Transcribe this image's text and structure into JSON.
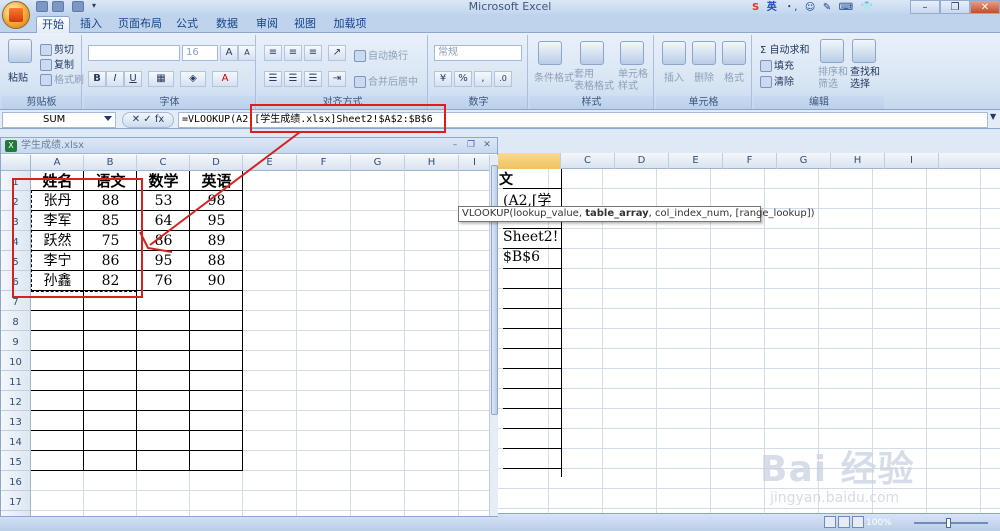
{
  "app": {
    "title": "Microsoft Excel",
    "ime_items": [
      "S",
      "英",
      "・,",
      "☺",
      "✎",
      "⌨",
      "♛",
      "👕",
      "✿"
    ]
  },
  "window_controls": {
    "minimize": "–",
    "restore": "❐",
    "close": "✕"
  },
  "ribbon_tabs": [
    "开始",
    "插入",
    "页面布局",
    "公式",
    "数据",
    "审阅",
    "视图",
    "加载项"
  ],
  "ribbon": {
    "clipboard": {
      "paste": "粘贴",
      "cut": "剪切",
      "copy": "复制",
      "format_painter": "格式刷",
      "label": "剪贴板"
    },
    "font": {
      "font_name": "",
      "font_size": "16",
      "grow": "A",
      "shrink": "A",
      "bold": "B",
      "italic": "I",
      "underline": "U",
      "label": "字体"
    },
    "alignment": {
      "wrap": "自动换行",
      "merge": "合并后居中",
      "label": "对齐方式"
    },
    "number": {
      "format": "常规",
      "percent": "%",
      "comma": ",",
      "label": "数字"
    },
    "styles": {
      "conditional": "条件格式",
      "table": "套用\n表格格式",
      "cell_styles": "单元格\n样式",
      "label": "样式"
    },
    "cells": {
      "insert": "插入",
      "delete": "删除",
      "format": "格式",
      "label": "单元格"
    },
    "editing": {
      "autosum": "Σ 自动求和",
      "fill": "填充",
      "clear": "清除",
      "sort": "排序和\n筛选",
      "find": "查找和\n选择",
      "label": "编辑"
    }
  },
  "formula_bar": {
    "name_box": "SUM",
    "buttons": "✕ ✓ fx",
    "formula": "=VLOOKUP(A2,[学生成绩.xlsx]Sheet2!$A$2:$B$6"
  },
  "tooltip": {
    "pre": "VLOOKUP(lookup_value, ",
    "bold": "table_array",
    "post": ", col_index_num, [range_lookup])"
  },
  "fg_window": {
    "title": "学生成绩.xlsx",
    "columns": [
      "A",
      "B",
      "C",
      "D",
      "E",
      "F",
      "G",
      "H",
      "I"
    ],
    "rows": [
      "1",
      "2",
      "3",
      "4",
      "5",
      "6",
      "7",
      "8",
      "9",
      "10",
      "11",
      "12",
      "13",
      "14",
      "15",
      "16",
      "17"
    ],
    "table": {
      "headers": [
        "姓名",
        "语文",
        "数学",
        "英语"
      ],
      "data": [
        [
          "张丹",
          "88",
          "53",
          "98"
        ],
        [
          "李军",
          "85",
          "64",
          "95"
        ],
        [
          "跃然",
          "75",
          "86",
          "89"
        ],
        [
          "李宁",
          "86",
          "95",
          "88"
        ],
        [
          "孙鑫",
          "82",
          "76",
          "90"
        ]
      ]
    }
  },
  "bg_window": {
    "columns": [
      "C",
      "D",
      "E",
      "F",
      "G",
      "H",
      "I"
    ],
    "cell_texts": {
      "header_fragment": "文",
      "formula_line1": "(A2,[学",
      "formula_line2": "Sheet2!",
      "formula_line3": "$B$6"
    }
  },
  "status": {
    "zoom": "100%"
  },
  "watermark": {
    "logo": "Bai 经验",
    "url": "jingyan.baidu.com"
  },
  "colors": {
    "annotation_red": "#d42121",
    "ribbon_blue": "#15428b"
  }
}
